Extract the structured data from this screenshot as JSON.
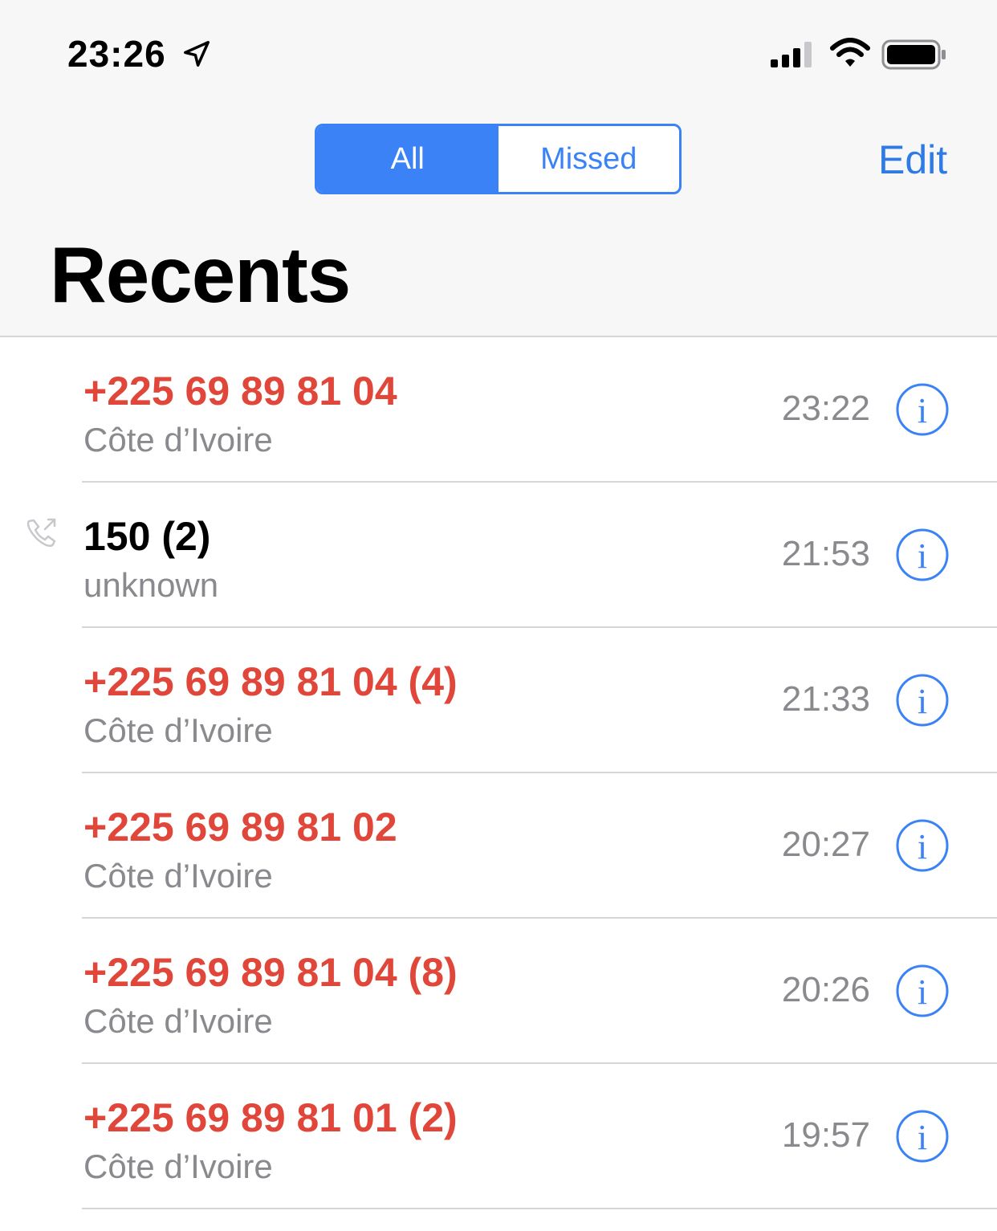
{
  "status_bar": {
    "time": "23:26",
    "icons": [
      "location-arrow-icon",
      "cellular-signal-icon",
      "wifi-icon",
      "battery-icon"
    ]
  },
  "nav": {
    "segments": [
      {
        "label": "All",
        "selected": true
      },
      {
        "label": "Missed",
        "selected": false
      }
    ],
    "edit_label": "Edit",
    "title": "Recents"
  },
  "colors": {
    "accent": "#3a82f6",
    "missed": "#e0473a",
    "secondary_text": "#8a8a8e"
  },
  "calls": [
    {
      "number": "+225 69 89 81 04",
      "label": "Côte d’Ivoire",
      "time": "23:22",
      "missed": true,
      "outgoing": false
    },
    {
      "number": "150 (2)",
      "label": "unknown",
      "time": "21:53",
      "missed": false,
      "outgoing": true
    },
    {
      "number": "+225 69 89 81 04 (4)",
      "label": "Côte d’Ivoire",
      "time": "21:33",
      "missed": true,
      "outgoing": false
    },
    {
      "number": "+225 69 89 81 02",
      "label": "Côte d’Ivoire",
      "time": "20:27",
      "missed": true,
      "outgoing": false
    },
    {
      "number": "+225 69 89 81 04 (8)",
      "label": "Côte d’Ivoire",
      "time": "20:26",
      "missed": true,
      "outgoing": false
    },
    {
      "number": "+225 69 89 81 01 (2)",
      "label": "Côte d’Ivoire",
      "time": "19:57",
      "missed": true,
      "outgoing": false
    }
  ]
}
